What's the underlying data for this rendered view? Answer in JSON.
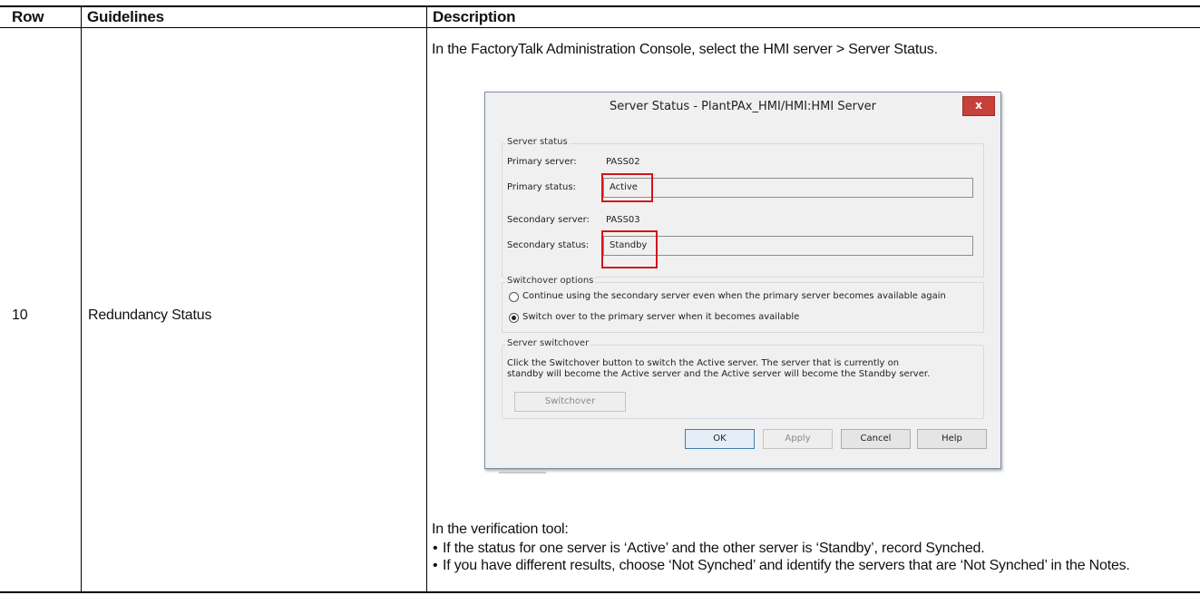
{
  "table": {
    "headers": [
      "Row",
      "Guidelines",
      "Description"
    ],
    "row": {
      "number": "10",
      "guideline": "Redundancy Status"
    }
  },
  "description": {
    "intro": "In the FactoryTalk Administration Console, select the HMI server > Server Status.",
    "verification_title": "In the verification tool:",
    "bullets": [
      "If the status for one server is ‘Active’ and the other server is ‘Standby’, record Synched.",
      "If you have different results, choose ‘Not Synched’ and identify the servers that are ‘Not Synched’ in the Notes."
    ]
  },
  "dialog": {
    "title": "Server Status - PlantPAx_HMI/HMI:HMI Server",
    "close_label": "x",
    "server_status": {
      "group_label": "Server status",
      "primary_server_label": "Primary server:",
      "primary_server_value": "PASS02",
      "primary_status_label": "Primary status:",
      "primary_status_value": "Active",
      "secondary_server_label": "Secondary server:",
      "secondary_server_value": "PASS03",
      "secondary_status_label": "Secondary status:",
      "secondary_status_value": "Standby"
    },
    "switchover_options": {
      "group_label": "Switchover options",
      "options": [
        {
          "label": "Continue using the secondary server even when the primary server becomes available again",
          "selected": false
        },
        {
          "label": "Switch over to the primary server when it becomes available",
          "selected": true
        }
      ]
    },
    "server_switchover": {
      "group_label": "Server switchover",
      "info_line1": "Click the Switchover button to switch the Active server.  The server that is currently on",
      "info_line2": "standby will become the Active server and the Active server will become the Standby server.",
      "button_label": "Switchover"
    },
    "buttons": {
      "ok": "OK",
      "apply": "Apply",
      "cancel": "Cancel",
      "help": "Help"
    },
    "highlight_color": "#d0161e"
  }
}
